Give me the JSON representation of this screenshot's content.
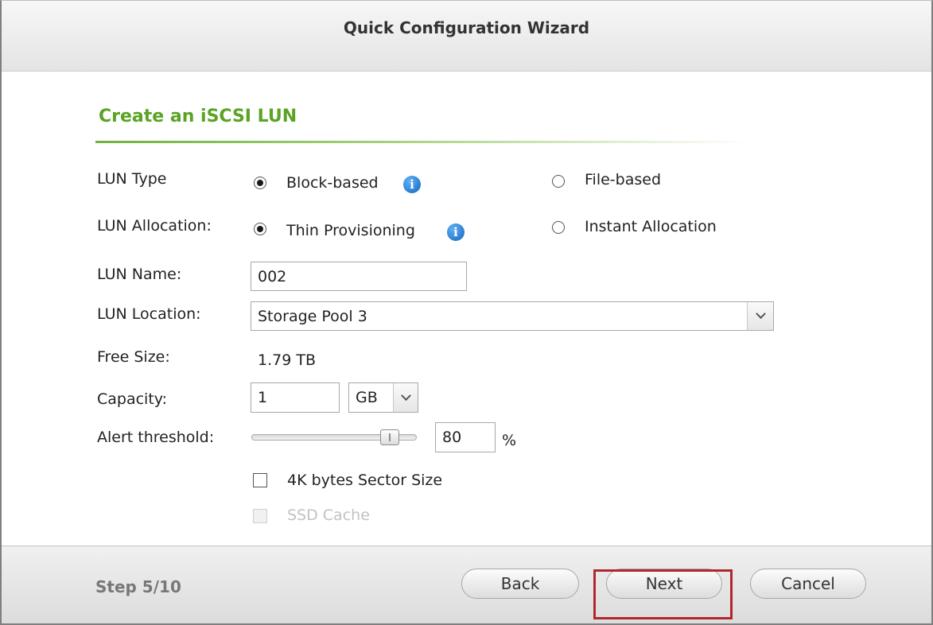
{
  "window": {
    "title": "Quick Configuration Wizard"
  },
  "section": {
    "title": "Create an iSCSI LUN"
  },
  "form": {
    "lun_type": {
      "label": "LUN Type",
      "option_1": "Block-based",
      "option_2": "File-based",
      "selected": "Block-based"
    },
    "lun_allocation": {
      "label": "LUN Allocation:",
      "option_1": "Thin Provisioning",
      "option_2": "Instant Allocation",
      "selected": "Thin Provisioning"
    },
    "lun_name": {
      "label": "LUN Name:",
      "value": "002"
    },
    "lun_location": {
      "label": "LUN Location:",
      "value": "Storage Pool 3"
    },
    "free_size": {
      "label": "Free Size:",
      "value": "1.79 TB"
    },
    "capacity": {
      "label": "Capacity:",
      "value": "1",
      "unit": "GB"
    },
    "alert_threshold": {
      "label": "Alert threshold:",
      "value": "80",
      "unit": "%",
      "slider_fraction": 0.8
    },
    "sector_size": {
      "label": "4K bytes Sector Size",
      "checked": false
    },
    "ssd_cache": {
      "label": "SSD Cache",
      "checked": false,
      "disabled": true
    }
  },
  "footer": {
    "step": "Step 5/10",
    "back_label": "Back",
    "next_label": "Next",
    "cancel_label": "Cancel"
  },
  "colors": {
    "section_title": "#5aa323",
    "highlight": "#b0282e",
    "info_icon": "#1565c0"
  },
  "icons": {
    "info": "info-circle",
    "dropdown": "chevron-down"
  }
}
